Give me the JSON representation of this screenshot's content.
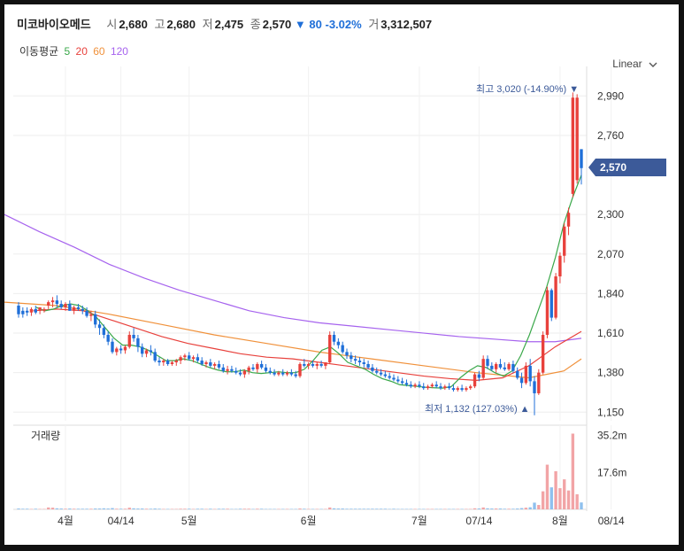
{
  "header": {
    "name": "미코바이오메드",
    "open_label": "시",
    "open": "2,680",
    "high_label": "고",
    "high": "2,680",
    "low_label": "저",
    "low": "2,475",
    "close_label": "종",
    "close": "2,570",
    "change": "▼ 80",
    "change_pct": "-3.02%",
    "volume_label": "거",
    "volume": "3,312,507"
  },
  "ma_legend": {
    "label": "이동평균",
    "items": [
      {
        "period": "5",
        "color": "#3aa84a"
      },
      {
        "period": "20",
        "color": "#e8413c"
      },
      {
        "period": "60",
        "color": "#f0913b"
      },
      {
        "period": "120",
        "color": "#a663ee"
      }
    ]
  },
  "scale_selector": {
    "label": "Linear"
  },
  "current_price_tag": "2,570",
  "max_label": "최고 3,020 (-14.90%) ▼",
  "min_label": "최저 1,132 (127.03%) ▲",
  "volume_panel_label": "거래량",
  "colors": {
    "up": "#e8413c",
    "down": "#1f6fd8",
    "up_vol": "#f2a4a6",
    "down_vol": "#8fc0ee",
    "tag": "#3c5a99"
  },
  "chart_data": {
    "type": "candlestick",
    "price_axis": {
      "ticks": [
        1150,
        1380,
        1610,
        1840,
        2070,
        2300,
        2760,
        2990
      ],
      "ylim": [
        1100,
        3110
      ]
    },
    "volume_axis": {
      "ticks": [
        "35.2m",
        "17.6m"
      ],
      "tick_values": [
        35.2,
        17.6
      ],
      "ylim": [
        0,
        38
      ]
    },
    "x_labels": [
      {
        "index": 11,
        "label": "4월"
      },
      {
        "index": 24,
        "label": "04/14"
      },
      {
        "index": 40,
        "label": "5월"
      },
      {
        "index": 68,
        "label": "6월"
      },
      {
        "index": 94,
        "label": "7월"
      },
      {
        "index": 108,
        "label": "07/14"
      },
      {
        "index": 127,
        "label": "8월"
      },
      {
        "index": 139,
        "label": "08/14"
      }
    ],
    "candles": [
      [
        1770,
        1790,
        1700,
        1720
      ],
      [
        1740,
        1760,
        1700,
        1720
      ],
      [
        1740,
        1760,
        1710,
        1730
      ],
      [
        1730,
        1760,
        1710,
        1750
      ],
      [
        1750,
        1770,
        1720,
        1730
      ],
      [
        1740,
        1760,
        1720,
        1760
      ],
      [
        1740,
        1760,
        1730,
        1750
      ],
      [
        1770,
        1800,
        1750,
        1790
      ],
      [
        1790,
        1820,
        1760,
        1800
      ],
      [
        1800,
        1830,
        1760,
        1780
      ],
      [
        1780,
        1800,
        1750,
        1760
      ],
      [
        1760,
        1790,
        1740,
        1780
      ],
      [
        1780,
        1800,
        1740,
        1740
      ],
      [
        1740,
        1770,
        1720,
        1760
      ],
      [
        1760,
        1780,
        1740,
        1750
      ],
      [
        1750,
        1770,
        1720,
        1740
      ],
      [
        1740,
        1760,
        1700,
        1710
      ],
      [
        1710,
        1740,
        1680,
        1720
      ],
      [
        1720,
        1740,
        1640,
        1660
      ],
      [
        1660,
        1690,
        1600,
        1640
      ],
      [
        1640,
        1660,
        1580,
        1600
      ],
      [
        1600,
        1620,
        1540,
        1560
      ],
      [
        1560,
        1580,
        1490,
        1500
      ],
      [
        1500,
        1530,
        1480,
        1520
      ],
      [
        1520,
        1540,
        1490,
        1510
      ],
      [
        1510,
        1540,
        1490,
        1530
      ],
      [
        1530,
        1620,
        1520,
        1600
      ],
      [
        1600,
        1640,
        1560,
        1580
      ],
      [
        1580,
        1600,
        1500,
        1530
      ],
      [
        1530,
        1550,
        1470,
        1490
      ],
      [
        1490,
        1520,
        1470,
        1510
      ],
      [
        1510,
        1540,
        1480,
        1500
      ],
      [
        1500,
        1520,
        1440,
        1450
      ],
      [
        1450,
        1470,
        1420,
        1440
      ],
      [
        1440,
        1460,
        1420,
        1450
      ],
      [
        1450,
        1460,
        1420,
        1430
      ],
      [
        1430,
        1450,
        1420,
        1440
      ],
      [
        1440,
        1460,
        1420,
        1450
      ],
      [
        1450,
        1480,
        1430,
        1470
      ],
      [
        1470,
        1490,
        1450,
        1480
      ],
      [
        1480,
        1500,
        1450,
        1460
      ],
      [
        1460,
        1480,
        1440,
        1470
      ],
      [
        1470,
        1490,
        1440,
        1450
      ],
      [
        1450,
        1470,
        1420,
        1430
      ],
      [
        1430,
        1450,
        1410,
        1440
      ],
      [
        1440,
        1460,
        1410,
        1420
      ],
      [
        1420,
        1440,
        1400,
        1430
      ],
      [
        1430,
        1450,
        1400,
        1410
      ],
      [
        1410,
        1430,
        1380,
        1390
      ],
      [
        1390,
        1420,
        1370,
        1400
      ],
      [
        1400,
        1420,
        1380,
        1390
      ],
      [
        1390,
        1410,
        1370,
        1380
      ],
      [
        1380,
        1400,
        1360,
        1370
      ],
      [
        1370,
        1400,
        1350,
        1390
      ],
      [
        1390,
        1420,
        1370,
        1410
      ],
      [
        1410,
        1430,
        1390,
        1400
      ],
      [
        1400,
        1440,
        1380,
        1430
      ],
      [
        1430,
        1450,
        1400,
        1410
      ],
      [
        1410,
        1430,
        1380,
        1390
      ],
      [
        1390,
        1410,
        1370,
        1380
      ],
      [
        1380,
        1400,
        1360,
        1370
      ],
      [
        1370,
        1390,
        1360,
        1380
      ],
      [
        1380,
        1400,
        1360,
        1370
      ],
      [
        1370,
        1390,
        1360,
        1380
      ],
      [
        1380,
        1400,
        1360,
        1370
      ],
      [
        1370,
        1390,
        1350,
        1360
      ],
      [
        1360,
        1440,
        1350,
        1430
      ],
      [
        1430,
        1460,
        1410,
        1420
      ],
      [
        1420,
        1440,
        1400,
        1430
      ],
      [
        1430,
        1450,
        1410,
        1420
      ],
      [
        1420,
        1440,
        1400,
        1430
      ],
      [
        1430,
        1450,
        1410,
        1420
      ],
      [
        1420,
        1440,
        1400,
        1440
      ],
      [
        1440,
        1620,
        1430,
        1600
      ],
      [
        1600,
        1620,
        1540,
        1560
      ],
      [
        1560,
        1580,
        1520,
        1540
      ],
      [
        1540,
        1560,
        1490,
        1500
      ],
      [
        1500,
        1520,
        1460,
        1480
      ],
      [
        1480,
        1500,
        1440,
        1460
      ],
      [
        1460,
        1480,
        1430,
        1450
      ],
      [
        1450,
        1470,
        1420,
        1440
      ],
      [
        1440,
        1460,
        1410,
        1430
      ],
      [
        1430,
        1450,
        1400,
        1410
      ],
      [
        1410,
        1430,
        1380,
        1390
      ],
      [
        1390,
        1410,
        1370,
        1380
      ],
      [
        1380,
        1400,
        1360,
        1370
      ],
      [
        1370,
        1390,
        1350,
        1360
      ],
      [
        1360,
        1380,
        1340,
        1350
      ],
      [
        1350,
        1370,
        1330,
        1340
      ],
      [
        1340,
        1360,
        1320,
        1330
      ],
      [
        1330,
        1350,
        1310,
        1320
      ],
      [
        1320,
        1340,
        1300,
        1310
      ],
      [
        1310,
        1330,
        1290,
        1300
      ],
      [
        1300,
        1320,
        1290,
        1310
      ],
      [
        1310,
        1330,
        1290,
        1300
      ],
      [
        1300,
        1320,
        1280,
        1290
      ],
      [
        1290,
        1310,
        1280,
        1300
      ],
      [
        1300,
        1320,
        1290,
        1310
      ],
      [
        1310,
        1330,
        1290,
        1300
      ],
      [
        1300,
        1320,
        1280,
        1290
      ],
      [
        1290,
        1310,
        1280,
        1300
      ],
      [
        1300,
        1320,
        1280,
        1290
      ],
      [
        1290,
        1310,
        1270,
        1280
      ],
      [
        1280,
        1300,
        1270,
        1290
      ],
      [
        1290,
        1310,
        1270,
        1280
      ],
      [
        1280,
        1300,
        1270,
        1290
      ],
      [
        1290,
        1310,
        1280,
        1300
      ],
      [
        1300,
        1380,
        1290,
        1370
      ],
      [
        1370,
        1390,
        1330,
        1350
      ],
      [
        1350,
        1480,
        1340,
        1460
      ],
      [
        1460,
        1480,
        1400,
        1420
      ],
      [
        1420,
        1440,
        1390,
        1400
      ],
      [
        1400,
        1440,
        1380,
        1430
      ],
      [
        1430,
        1460,
        1400,
        1410
      ],
      [
        1410,
        1440,
        1390,
        1400
      ],
      [
        1400,
        1440,
        1390,
        1430
      ],
      [
        1430,
        1450,
        1380,
        1390
      ],
      [
        1390,
        1410,
        1340,
        1350
      ],
      [
        1350,
        1380,
        1290,
        1320
      ],
      [
        1320,
        1440,
        1310,
        1420
      ],
      [
        1420,
        1460,
        1300,
        1330
      ],
      [
        1330,
        1360,
        1132,
        1260
      ],
      [
        1260,
        1400,
        1250,
        1380
      ],
      [
        1380,
        1620,
        1370,
        1600
      ],
      [
        1600,
        1880,
        1580,
        1860
      ],
      [
        1860,
        1870,
        1680,
        1700
      ],
      [
        1700,
        1960,
        1690,
        1940
      ],
      [
        1940,
        2080,
        1900,
        2060
      ],
      [
        2060,
        2250,
        2020,
        2230
      ],
      [
        2230,
        2340,
        2180,
        2310
      ],
      [
        2420,
        3010,
        2400,
        2980
      ],
      [
        2500,
        3000,
        2480,
        2980
      ],
      [
        2680,
        2680,
        2475,
        2570
      ]
    ],
    "volume_m": [
      0.4,
      0.3,
      0.3,
      0.2,
      0.3,
      0.2,
      0.2,
      0.9,
      0.8,
      0.5,
      0.4,
      0.3,
      0.4,
      0.3,
      0.3,
      0.3,
      0.3,
      0.3,
      0.4,
      0.4,
      0.5,
      0.4,
      0.6,
      0.3,
      0.3,
      0.3,
      0.8,
      0.5,
      0.4,
      0.4,
      0.3,
      0.3,
      0.4,
      0.3,
      0.2,
      0.2,
      0.2,
      0.2,
      0.3,
      0.3,
      0.3,
      0.2,
      0.3,
      0.3,
      0.2,
      0.3,
      0.2,
      0.3,
      0.3,
      0.3,
      0.2,
      0.2,
      0.3,
      0.3,
      0.3,
      0.2,
      0.3,
      0.3,
      0.2,
      0.2,
      0.2,
      0.2,
      0.2,
      0.2,
      0.2,
      0.2,
      0.4,
      0.3,
      0.2,
      0.2,
      0.2,
      0.2,
      0.2,
      0.9,
      0.5,
      0.4,
      0.4,
      0.3,
      0.3,
      0.3,
      0.3,
      0.3,
      0.3,
      0.3,
      0.3,
      0.3,
      0.3,
      0.2,
      0.3,
      0.2,
      0.2,
      0.2,
      0.2,
      0.2,
      0.2,
      0.2,
      0.2,
      0.2,
      0.2,
      0.2,
      0.2,
      0.2,
      0.2,
      0.2,
      0.2,
      0.2,
      0.2,
      0.5,
      0.4,
      0.9,
      0.5,
      0.4,
      0.4,
      0.4,
      0.3,
      0.3,
      0.3,
      0.4,
      0.6,
      0.8,
      1.0,
      3.2,
      2.1,
      8.6,
      21.3,
      10.5,
      18.2,
      10.1,
      14.3,
      9.0,
      36.1,
      7.2,
      3.3
    ],
    "ma5_pts": [
      [
        22,
        1760
      ],
      [
        28,
        1740
      ],
      [
        34,
        1750
      ],
      [
        40,
        1770
      ],
      [
        46,
        1780
      ],
      [
        52,
        1770
      ],
      [
        58,
        1740
      ],
      [
        64,
        1700
      ],
      [
        70,
        1640
      ],
      [
        76,
        1580
      ],
      [
        82,
        1540
      ],
      [
        88,
        1540
      ],
      [
        94,
        1530
      ],
      [
        100,
        1510
      ],
      [
        106,
        1480
      ],
      [
        112,
        1450
      ],
      [
        118,
        1450
      ],
      [
        124,
        1460
      ],
      [
        130,
        1450
      ],
      [
        136,
        1430
      ],
      [
        142,
        1410
      ],
      [
        148,
        1395
      ],
      [
        154,
        1385
      ],
      [
        160,
        1385
      ],
      [
        166,
        1395
      ],
      [
        172,
        1380
      ],
      [
        178,
        1375
      ],
      [
        184,
        1380
      ],
      [
        190,
        1385
      ],
      [
        196,
        1380
      ],
      [
        202,
        1380
      ],
      [
        208,
        1400
      ],
      [
        214,
        1450
      ],
      [
        220,
        1510
      ],
      [
        226,
        1530
      ],
      [
        232,
        1490
      ],
      [
        238,
        1440
      ],
      [
        244,
        1420
      ],
      [
        250,
        1400
      ],
      [
        256,
        1370
      ],
      [
        262,
        1345
      ],
      [
        268,
        1330
      ],
      [
        274,
        1310
      ],
      [
        280,
        1305
      ],
      [
        286,
        1300
      ],
      [
        292,
        1295
      ],
      [
        298,
        1292
      ],
      [
        304,
        1290
      ],
      [
        310,
        1300
      ],
      [
        316,
        1350
      ],
      [
        322,
        1390
      ],
      [
        328,
        1420
      ],
      [
        334,
        1410
      ],
      [
        340,
        1380
      ],
      [
        346,
        1360
      ],
      [
        352,
        1390
      ],
      [
        358,
        1480
      ],
      [
        364,
        1600
      ],
      [
        370,
        1740
      ],
      [
        376,
        1880
      ],
      [
        382,
        2050
      ],
      [
        388,
        2250
      ],
      [
        394,
        2400
      ],
      [
        400,
        2530
      ]
    ],
    "ma20_pts": [
      [
        22,
        1740
      ],
      [
        40,
        1750
      ],
      [
        60,
        1740
      ],
      [
        80,
        1690
      ],
      [
        100,
        1640
      ],
      [
        120,
        1590
      ],
      [
        140,
        1550
      ],
      [
        160,
        1520
      ],
      [
        180,
        1490
      ],
      [
        200,
        1470
      ],
      [
        220,
        1460
      ],
      [
        240,
        1440
      ],
      [
        260,
        1420
      ],
      [
        280,
        1400
      ],
      [
        300,
        1380
      ],
      [
        320,
        1360
      ],
      [
        340,
        1345
      ],
      [
        360,
        1335
      ],
      [
        380,
        1350
      ],
      [
        400,
        1420
      ],
      [
        420,
        1530
      ],
      [
        440,
        1620
      ]
    ],
    "ma60_pts": [
      [
        0,
        1790
      ],
      [
        60,
        1770
      ],
      [
        120,
        1720
      ],
      [
        180,
        1660
      ],
      [
        240,
        1600
      ],
      [
        300,
        1550
      ],
      [
        360,
        1500
      ],
      [
        420,
        1460
      ],
      [
        480,
        1420
      ],
      [
        540,
        1380
      ],
      [
        600,
        1350
      ],
      [
        640,
        1390
      ],
      [
        660,
        1460
      ]
    ],
    "ma120_pts": [
      [
        0,
        2300
      ],
      [
        40,
        2200
      ],
      [
        80,
        2110
      ],
      [
        120,
        2010
      ],
      [
        160,
        1930
      ],
      [
        200,
        1860
      ],
      [
        240,
        1800
      ],
      [
        280,
        1740
      ],
      [
        320,
        1700
      ],
      [
        360,
        1670
      ],
      [
        400,
        1650
      ],
      [
        440,
        1630
      ],
      [
        480,
        1610
      ],
      [
        520,
        1590
      ],
      [
        560,
        1575
      ],
      [
        600,
        1560
      ],
      [
        630,
        1560
      ],
      [
        660,
        1580
      ]
    ]
  }
}
